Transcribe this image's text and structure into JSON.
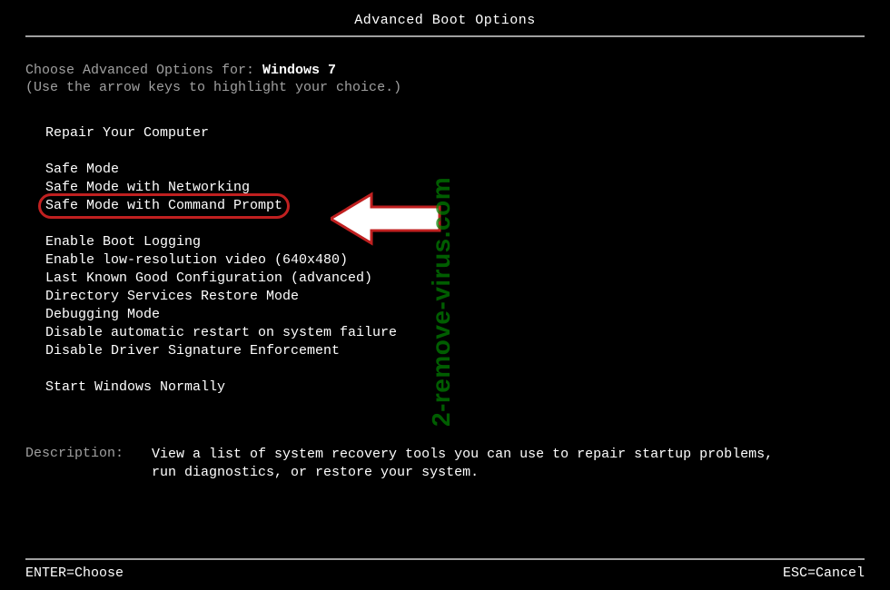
{
  "title": "Advanced Boot Options",
  "choose_prefix": "Choose Advanced Options for: ",
  "os_name": "Windows 7",
  "hint": "(Use the arrow keys to highlight your choice.)",
  "groups": {
    "repair": [
      "Repair Your Computer"
    ],
    "safe": [
      "Safe Mode",
      "Safe Mode with Networking",
      "Safe Mode with Command Prompt"
    ],
    "advanced": [
      "Enable Boot Logging",
      "Enable low-resolution video (640x480)",
      "Last Known Good Configuration (advanced)",
      "Directory Services Restore Mode",
      "Debugging Mode",
      "Disable automatic restart on system failure",
      "Disable Driver Signature Enforcement"
    ],
    "normal": [
      "Start Windows Normally"
    ]
  },
  "selected_index": 2,
  "description_label": "Description:",
  "description_text": "View a list of system recovery tools you can use to repair startup problems, run diagnostics, or restore your system.",
  "footer": {
    "enter": "ENTER=Choose",
    "esc": "ESC=Cancel"
  },
  "watermark": "2-remove-virus.com",
  "annotation": {
    "highlight_color": "#c02020"
  }
}
